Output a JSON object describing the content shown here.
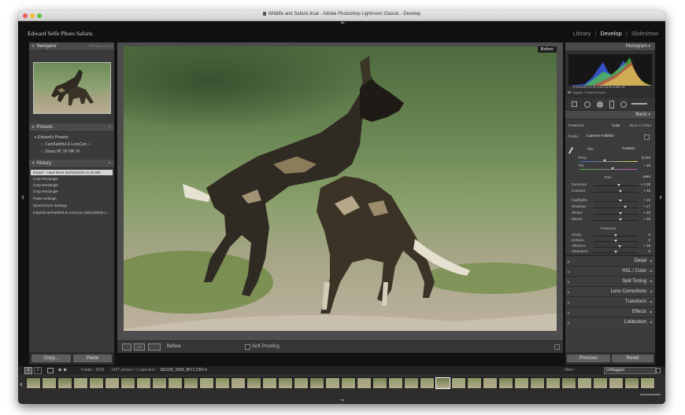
{
  "window": {
    "title": "Wildlife and Safaris.lrcat - Adobe Photoshop Lightroom Classic - Develop"
  },
  "identity_plate": "Edward Selfe Photo Safaris",
  "modules": [
    "Library",
    "Develop",
    "Slideshow"
  ],
  "active_module": "Develop",
  "navigator": {
    "title": "Navigator",
    "zoom_options": "FIT  FILL  1:1  1:3"
  },
  "presets": {
    "title": "Presets",
    "group": "Edward's Presets",
    "items": [
      "CamFaithful & LensCorr",
      "Sharp 90, 50 NR 10"
    ]
  },
  "history": {
    "title": "History",
    "items": [
      "Export - Hard Drive (01/01/2019 11:42:09)",
      "Crop Rectangle",
      "Crop Rectangle",
      "Crop Rectangle",
      "Paste Settings",
      "Synchronize Settings",
      "Import/CamFaithful & LensCorr (29/12/2018 1..."
    ]
  },
  "left_buttons": {
    "copy": "Copy...",
    "paste": "Paste"
  },
  "photo": {
    "before_label": "Before"
  },
  "toolbar": {
    "before_label": "Before",
    "soft_proofing": "Soft Proofing"
  },
  "histogram": {
    "title": "Histogram",
    "readout": "R 53.8 68.3  G 57.0 66.5  B 52.8 58.1 %",
    "preview_label": "Original + Smart Preview"
  },
  "basic": {
    "title": "Basic",
    "treatment_label": "Treatment :",
    "treatment_color": "Color",
    "treatment_bw": "Black & White",
    "profile_label": "Profile :",
    "profile_value": "Camera Faithful",
    "wb_label": "WB :",
    "wb_value": "Custom",
    "temp_label": "Temp",
    "temp_value": "5,245",
    "tint_label": "Tint",
    "tint_value": "+ 30",
    "tone_label": "Tone",
    "tone_auto": "Auto",
    "exposure_label": "Exposure",
    "exposure_value": "+ 0.35",
    "contrast_label": "Contrast",
    "contrast_value": "+ 25",
    "highlights_label": "Highlights",
    "highlights_value": "+ 22",
    "shadows_label": "Shadows",
    "shadows_value": "+ 47",
    "whites_label": "Whites",
    "whites_value": "+ 26",
    "blacks_label": "Blacks",
    "blacks_value": "+ 25",
    "presence_label": "Presence",
    "clarity_label": "Clarity",
    "clarity_value": "0",
    "dehaze_label": "Dehaze",
    "dehaze_value": "0",
    "vibrance_label": "Vibrance",
    "vibrance_value": "+ 18",
    "saturation_label": "Saturation",
    "saturation_value": "0"
  },
  "collapsed_panels": [
    "Detail",
    "HSL / Color",
    "Split Toning",
    "Lens Corrections",
    "Transform",
    "Effects",
    "Calibration"
  ],
  "right_buttons": {
    "previous": "Previous",
    "reset": "Reset"
  },
  "filmstrip_bar": {
    "page1": "1",
    "page2": "2",
    "folder": "Folder : 2018",
    "count": "1467 photos / 1 selected /",
    "filename": "181229_1659_8571.CR2",
    "filter_label": "Filter :",
    "filter_value": "Unflagged"
  },
  "colors": {
    "panel_bg": "#3c3c3c",
    "app_bg": "#111111",
    "histogram_red": "#d9413a",
    "histogram_green": "#4fc44a",
    "histogram_blue": "#3d5ce6"
  }
}
